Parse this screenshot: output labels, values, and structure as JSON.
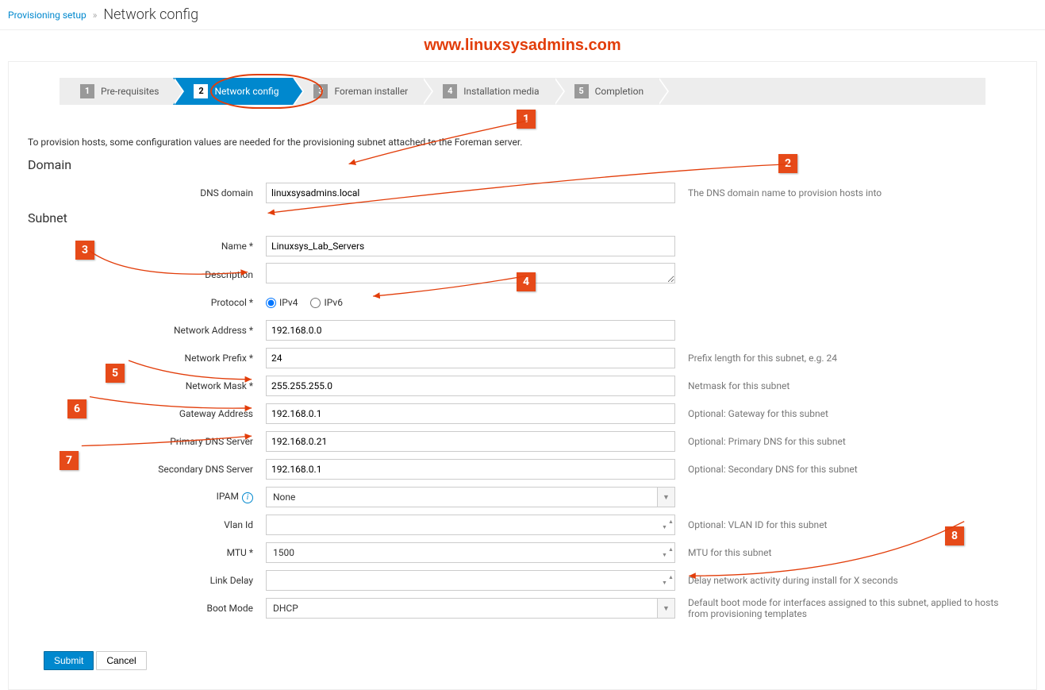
{
  "breadcrumb": {
    "root": "Provisioning setup",
    "current": "Network config"
  },
  "watermark": "www.linuxsysadmins.com",
  "wizard": {
    "steps": [
      {
        "num": "1",
        "label": "Pre-requisites"
      },
      {
        "num": "2",
        "label": "Network config"
      },
      {
        "num": "3",
        "label": "Foreman installer"
      },
      {
        "num": "4",
        "label": "Installation media"
      },
      {
        "num": "5",
        "label": "Completion"
      }
    ]
  },
  "intro": "To provision hosts, some configuration values are needed for the provisioning subnet attached to the Foreman server.",
  "domain": {
    "title": "Domain",
    "dns_label": "DNS domain",
    "dns_value": "linuxsysadmins.local",
    "dns_help": "The DNS domain name to provision hosts into"
  },
  "subnet": {
    "title": "Subnet",
    "name_label": "Name *",
    "name_value": "Linuxsys_Lab_Servers",
    "desc_label": "Description",
    "desc_value": "",
    "proto_label": "Protocol *",
    "proto_ipv4": "IPv4",
    "proto_ipv6": "IPv6",
    "netaddr_label": "Network Address *",
    "netaddr_value": "192.168.0.0",
    "prefix_label": "Network Prefix *",
    "prefix_value": "24",
    "prefix_help": "Prefix length for this subnet, e.g. 24",
    "mask_label": "Network Mask *",
    "mask_value": "255.255.255.0",
    "mask_help": "Netmask for this subnet",
    "gateway_label": "Gateway Address",
    "gateway_value": "192.168.0.1",
    "gateway_help": "Optional: Gateway for this subnet",
    "dns1_label": "Primary DNS Server",
    "dns1_value": "192.168.0.21",
    "dns1_help": "Optional: Primary DNS for this subnet",
    "dns2_label": "Secondary DNS Server",
    "dns2_value": "192.168.0.1",
    "dns2_help": "Optional: Secondary DNS for this subnet",
    "ipam_label": "IPAM",
    "ipam_value": "None",
    "vlan_label": "Vlan Id",
    "vlan_value": "",
    "vlan_help": "Optional: VLAN ID for this subnet",
    "mtu_label": "MTU *",
    "mtu_value": "1500",
    "mtu_help": "MTU for this subnet",
    "linkdelay_label": "Link Delay",
    "linkdelay_value": "",
    "linkdelay_help": "Delay network activity during install for X seconds",
    "bootmode_label": "Boot Mode",
    "bootmode_value": "DHCP",
    "bootmode_help": "Default boot mode for interfaces assigned to this subnet, applied to hosts from provisioning templates"
  },
  "actions": {
    "submit": "Submit",
    "cancel": "Cancel"
  },
  "callouts": [
    "1",
    "2",
    "3",
    "4",
    "5",
    "6",
    "7",
    "8"
  ]
}
